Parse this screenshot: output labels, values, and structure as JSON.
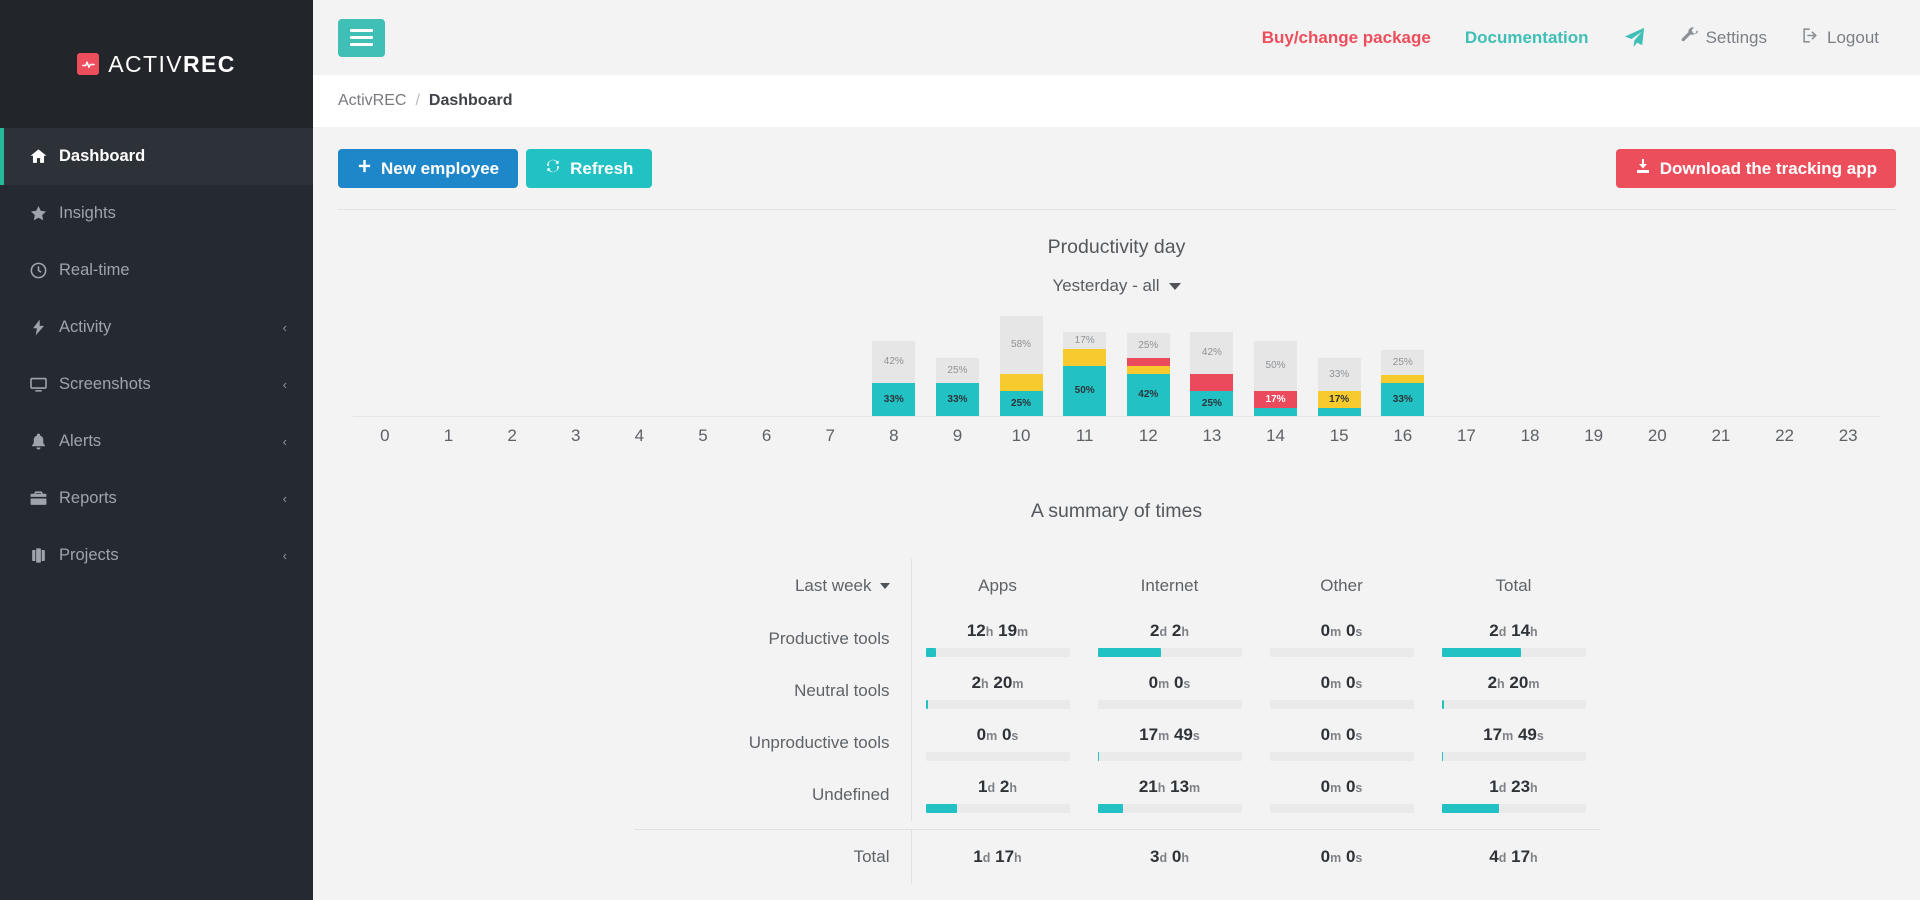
{
  "brand": {
    "name_light": "ACTIV",
    "name_bold": "REC",
    "mark_icon": "pulse-icon"
  },
  "sidebar": {
    "items": [
      {
        "label": "Dashboard",
        "icon": "home-icon",
        "active": true,
        "caret": ""
      },
      {
        "label": "Insights",
        "icon": "star-icon",
        "active": false,
        "caret": ""
      },
      {
        "label": "Real-time",
        "icon": "clock-icon",
        "active": false,
        "caret": ""
      },
      {
        "label": "Activity",
        "icon": "bolt-icon",
        "active": false,
        "caret": "‹"
      },
      {
        "label": "Screenshots",
        "icon": "monitor-icon",
        "active": false,
        "caret": "‹"
      },
      {
        "label": "Alerts",
        "icon": "bell-icon",
        "active": false,
        "caret": "‹"
      },
      {
        "label": "Reports",
        "icon": "briefcase-icon",
        "active": false,
        "caret": "‹"
      },
      {
        "label": "Projects",
        "icon": "suitcase-icon",
        "active": false,
        "caret": "‹"
      }
    ]
  },
  "topbar": {
    "menu_toggle_icon": "hamburger-icon",
    "buy_label": "Buy/change package",
    "documentation_label": "Documentation",
    "send_icon": "paper-plane-icon",
    "settings_label": "Settings",
    "settings_icon": "wrench-icon",
    "logout_label": "Logout",
    "logout_icon": "sign-out-icon"
  },
  "breadcrumb": {
    "root": "ActivREC",
    "separator": "/",
    "current": "Dashboard"
  },
  "actions": {
    "new_employee_label": "New employee",
    "new_employee_icon": "plus-icon",
    "refresh_label": "Refresh",
    "refresh_icon": "refresh-icon",
    "download_label": "Download the tracking app",
    "download_icon": "download-icon"
  },
  "productivity": {
    "title": "Productivity day",
    "range_label": "Yesterday - all",
    "range_caret_icon": "chevron-down-icon"
  },
  "summary": {
    "title": "A summary of times",
    "period_label": "Last week",
    "period_caret_icon": "chevron-down-icon",
    "columns": [
      "Apps",
      "Internet",
      "Other",
      "Total"
    ],
    "total_row_label": "Total"
  },
  "chart_data": [
    {
      "type": "bar",
      "title": "Productivity day",
      "subtitle": "Yesterday - all",
      "stacked": true,
      "xlabel": "",
      "ylabel": "",
      "ylim": [
        0,
        100
      ],
      "grid": false,
      "legend": "none",
      "categories": [
        "0",
        "1",
        "2",
        "3",
        "4",
        "5",
        "6",
        "7",
        "8",
        "9",
        "10",
        "11",
        "12",
        "13",
        "14",
        "15",
        "16",
        "17",
        "18",
        "19",
        "20",
        "21",
        "22",
        "23"
      ],
      "series": [
        {
          "name": "Productive",
          "color": "#21c1c4",
          "values": [
            0,
            0,
            0,
            0,
            0,
            0,
            0,
            0,
            33,
            33,
            25,
            50,
            42,
            25,
            8,
            8,
            33,
            0,
            0,
            0,
            0,
            0,
            0,
            0
          ]
        },
        {
          "name": "Neutral",
          "color": "#f7cb2e",
          "values": [
            0,
            0,
            0,
            0,
            0,
            0,
            0,
            0,
            0,
            0,
            17,
            17,
            8,
            0,
            0,
            17,
            8,
            0,
            0,
            0,
            0,
            0,
            0,
            0
          ]
        },
        {
          "name": "Unproductive",
          "color": "#ea4a5c",
          "values": [
            0,
            0,
            0,
            0,
            0,
            0,
            0,
            0,
            0,
            0,
            0,
            0,
            8,
            17,
            17,
            0,
            0,
            0,
            0,
            0,
            0,
            0,
            0,
            0
          ]
        },
        {
          "name": "Undefined",
          "color": "#e6e6e6",
          "values": [
            0,
            0,
            0,
            0,
            0,
            0,
            0,
            0,
            42,
            25,
            58,
            17,
            25,
            42,
            50,
            33,
            25,
            0,
            0,
            0,
            0,
            0,
            0,
            0
          ]
        }
      ],
      "bar_labels": [
        {
          "hour": "8",
          "segments": [
            {
              "label": "42%",
              "series": "Undefined"
            },
            {
              "label": "33%",
              "series": "Productive"
            }
          ]
        },
        {
          "hour": "9",
          "segments": [
            {
              "label": "25%",
              "series": "Undefined"
            },
            {
              "label": "33%",
              "series": "Productive"
            }
          ]
        },
        {
          "hour": "10",
          "segments": [
            {
              "label": "58%",
              "series": "Undefined"
            },
            {
              "label": "",
              "series": "Neutral"
            },
            {
              "label": "25%",
              "series": "Productive"
            }
          ]
        },
        {
          "hour": "11",
          "segments": [
            {
              "label": "17%",
              "series": "Undefined"
            },
            {
              "label": "",
              "series": "Neutral"
            },
            {
              "label": "50%",
              "series": "Productive"
            }
          ]
        },
        {
          "hour": "12",
          "segments": [
            {
              "label": "25%",
              "series": "Undefined"
            },
            {
              "label": "",
              "series": "Unproductive"
            },
            {
              "label": "",
              "series": "Neutral"
            },
            {
              "label": "42%",
              "series": "Productive"
            }
          ]
        },
        {
          "hour": "13",
          "segments": [
            {
              "label": "42%",
              "series": "Undefined"
            },
            {
              "label": "",
              "series": "Unproductive"
            },
            {
              "label": "25%",
              "series": "Productive"
            }
          ]
        },
        {
          "hour": "14",
          "segments": [
            {
              "label": "50%",
              "series": "Undefined"
            },
            {
              "label": "17%",
              "series": "Unproductive"
            },
            {
              "label": "",
              "series": "Productive"
            }
          ]
        },
        {
          "hour": "15",
          "segments": [
            {
              "label": "33%",
              "series": "Undefined"
            },
            {
              "label": "17%",
              "series": "Neutral"
            },
            {
              "label": "",
              "series": "Productive"
            }
          ]
        },
        {
          "hour": "16",
          "segments": [
            {
              "label": "25%",
              "series": "Undefined"
            },
            {
              "label": "",
              "series": "Neutral"
            },
            {
              "label": "33%",
              "series": "Productive"
            }
          ]
        }
      ]
    },
    {
      "type": "table",
      "title": "A summary of times",
      "period": "Last week",
      "columns": [
        "Apps",
        "Internet",
        "Other",
        "Total"
      ],
      "rows": [
        {
          "label": "Productive tools",
          "cells": [
            {
              "value": "12h 19m",
              "num1": "12",
              "unit1": "h",
              "num2": "19",
              "unit2": "m",
              "pct": 7
            },
            {
              "value": "2d 2h",
              "num1": "2",
              "unit1": "d",
              "num2": "2",
              "unit2": "h",
              "pct": 44
            },
            {
              "value": "0m 0s",
              "num1": "0",
              "unit1": "m",
              "num2": "0",
              "unit2": "s",
              "pct": 0
            },
            {
              "value": "2d 14h",
              "num1": "2",
              "unit1": "d",
              "num2": "14",
              "unit2": "h",
              "pct": 55
            }
          ]
        },
        {
          "label": "Neutral tools",
          "cells": [
            {
              "value": "2h 20m",
              "num1": "2",
              "unit1": "h",
              "num2": "20",
              "unit2": "m",
              "pct": 2
            },
            {
              "value": "0m 0s",
              "num1": "0",
              "unit1": "m",
              "num2": "0",
              "unit2": "s",
              "pct": 0
            },
            {
              "value": "0m 0s",
              "num1": "0",
              "unit1": "m",
              "num2": "0",
              "unit2": "s",
              "pct": 0
            },
            {
              "value": "2h 20m",
              "num1": "2",
              "unit1": "h",
              "num2": "20",
              "unit2": "m",
              "pct": 2
            }
          ]
        },
        {
          "label": "Unproductive tools",
          "cells": [
            {
              "value": "0m 0s",
              "num1": "0",
              "unit1": "m",
              "num2": "0",
              "unit2": "s",
              "pct": 0
            },
            {
              "value": "17m 49s",
              "num1": "17",
              "unit1": "m",
              "num2": "49",
              "unit2": "s",
              "pct": 1
            },
            {
              "value": "0m 0s",
              "num1": "0",
              "unit1": "m",
              "num2": "0",
              "unit2": "s",
              "pct": 0
            },
            {
              "value": "17m 49s",
              "num1": "17",
              "unit1": "m",
              "num2": "49",
              "unit2": "s",
              "pct": 1
            }
          ]
        },
        {
          "label": "Undefined",
          "cells": [
            {
              "value": "1d 2h",
              "num1": "1",
              "unit1": "d",
              "num2": "2",
              "unit2": "h",
              "pct": 22
            },
            {
              "value": "21h 13m",
              "num1": "21",
              "unit1": "h",
              "num2": "13",
              "unit2": "m",
              "pct": 18
            },
            {
              "value": "0m 0s",
              "num1": "0",
              "unit1": "m",
              "num2": "0",
              "unit2": "s",
              "pct": 0
            },
            {
              "value": "1d 23h",
              "num1": "1",
              "unit1": "d",
              "num2": "23",
              "unit2": "h",
              "pct": 40
            }
          ]
        }
      ],
      "total_row": {
        "label": "Total",
        "cells": [
          {
            "value": "1d 17h",
            "num1": "1",
            "unit1": "d",
            "num2": "17",
            "unit2": "h"
          },
          {
            "value": "3d 0h",
            "num1": "3",
            "unit1": "d",
            "num2": "0",
            "unit2": "h"
          },
          {
            "value": "0m 0s",
            "num1": "0",
            "unit1": "m",
            "num2": "0",
            "unit2": "s"
          },
          {
            "value": "4d 17h",
            "num1": "4",
            "unit1": "d",
            "num2": "17",
            "unit2": "h"
          }
        ]
      }
    }
  ],
  "colors": {
    "sidebar_bg": "#252a30",
    "accent_teal": "#21c1c4",
    "accent_red": "#ed4e5c",
    "accent_blue": "#1e87c9",
    "accent_yellow": "#f7cb2e",
    "active_marker": "#25b99a",
    "undefined_gray": "#e6e6e6"
  }
}
